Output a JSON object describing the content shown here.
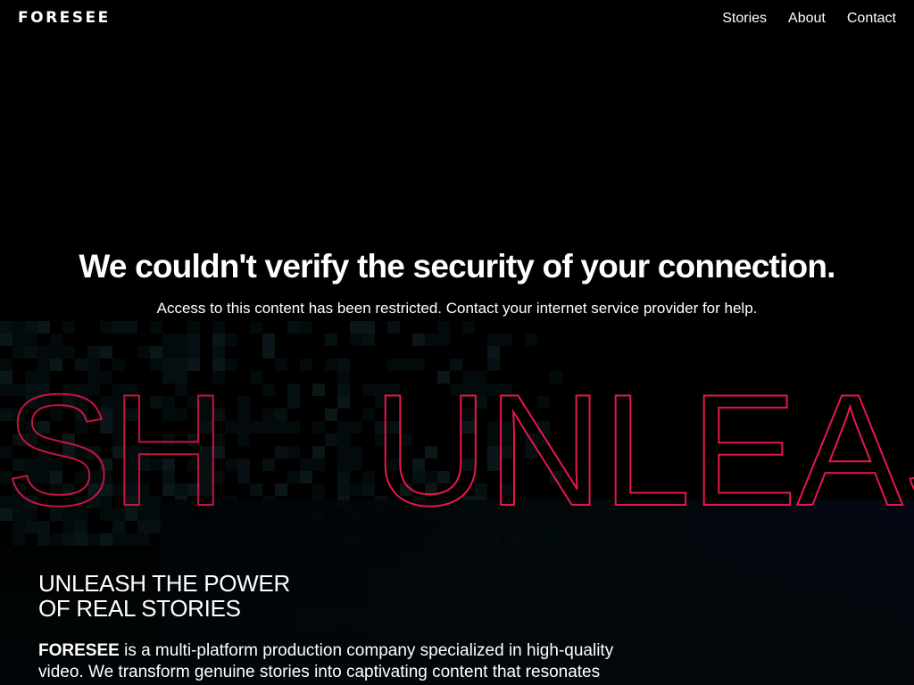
{
  "header": {
    "logo": "FORESEE",
    "nav": [
      "Stories",
      "About",
      "Contact"
    ]
  },
  "error": {
    "title": "We couldn't verify the security of your connection.",
    "message": "Access to this content has been restricted. Contact your internet service provider for help."
  },
  "background": {
    "outline_text": "UNLEAS",
    "outline_text_left": "SH",
    "accent_color": "#e8174a"
  },
  "hero": {
    "title_line1": "UNLEASH THE POWER",
    "title_line2": "OF REAL STORIES",
    "body_brand": "FORESEE",
    "body_line1_rest": " is a multi-platform production company specialized in high-quality",
    "body_line2": "video. We transform genuine stories into captivating content that resonates"
  }
}
